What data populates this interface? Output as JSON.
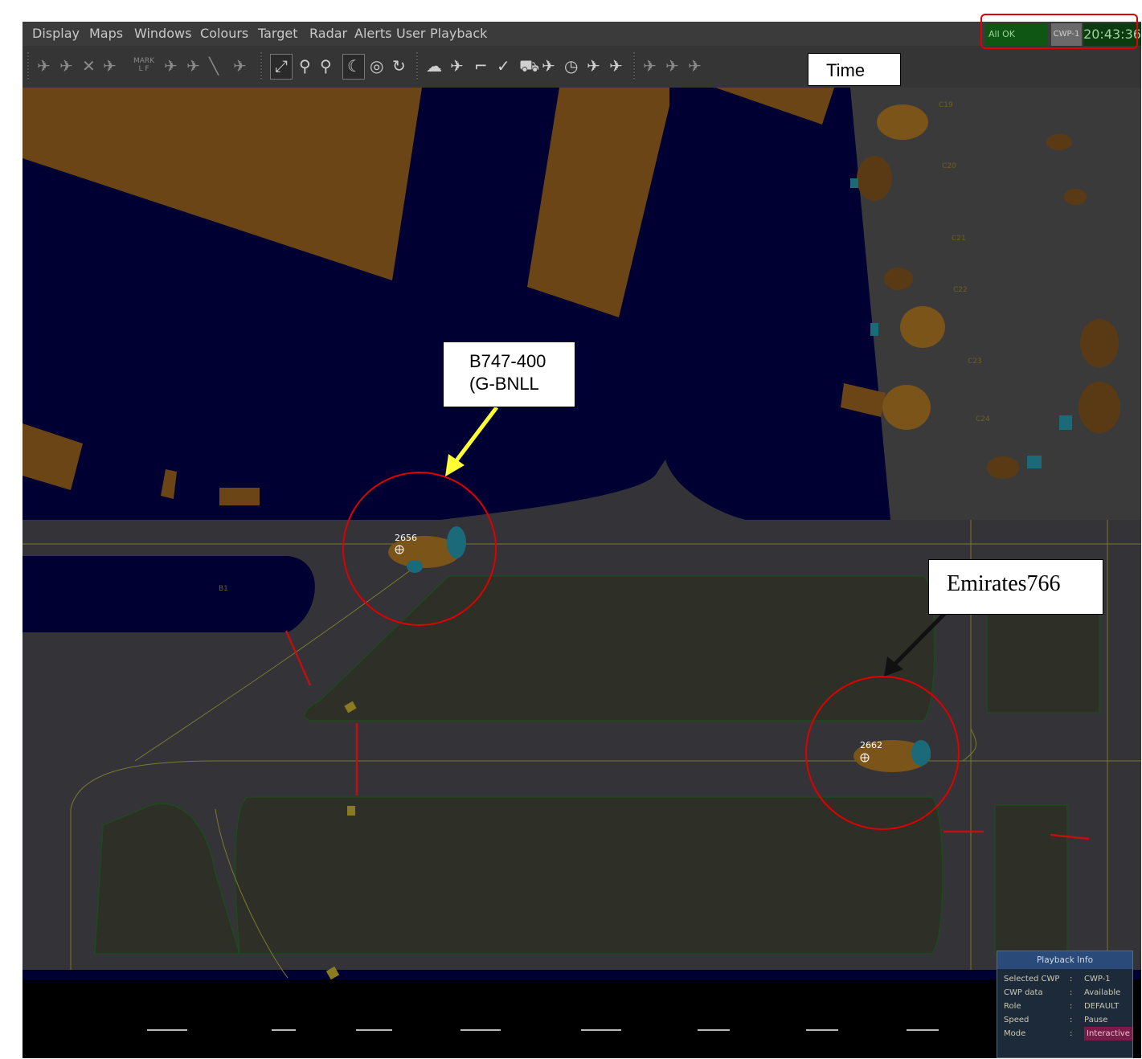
{
  "menu": {
    "items": [
      "Display",
      "Maps",
      "Windows",
      "Colours",
      "Target",
      "Radar",
      "Alerts",
      "User",
      "Playback"
    ]
  },
  "toolbar": {
    "mark_tool_label_top": "MARK",
    "mark_tool_label_bottom": "L F",
    "icons": [
      "track-icon",
      "aircraft-psr-icon",
      "cross-plane-icon",
      "label-plane-icon",
      "mark-icon",
      "plane-a-icon",
      "plane-b-icon",
      "runway-icon",
      "plane-c-icon",
      "pin-tool-icon",
      "zoom-out-icon",
      "zoom-in-icon",
      "moon-icon",
      "radar-circle-icon",
      "refresh-icon",
      "weather-icon",
      "plane-zero-icon",
      "boot-icon",
      "checkmark-icon",
      "vehicle-icon",
      "search-plane-icon",
      "clock-icon",
      "jet-icon",
      "jet-alt-icon",
      "plane-mark-icon",
      "only-icon",
      "mark-plus-icon"
    ]
  },
  "status": {
    "system_status": "All OK",
    "cwp": "CWP-1",
    "time": "20:43:36"
  },
  "annotations": {
    "time_label": "Time",
    "aircraft_1_line1": "B747-400",
    "aircraft_1_line2": "(G-BNLL",
    "aircraft_2": "Emirates766"
  },
  "targets": [
    {
      "id": "2656"
    },
    {
      "id": "2662"
    }
  ],
  "map_labels": {
    "stand_b1": "B1",
    "stand_c19": "C19",
    "stand_c20": "C20",
    "stand_c21": "C21",
    "stand_c22": "C22",
    "stand_c23": "C23",
    "stand_c24": "C24"
  },
  "playback_info": {
    "title": "Playback Info",
    "rows": [
      {
        "key": "Selected CWP",
        "value": "CWP-1"
      },
      {
        "key": "CWP data",
        "value": "Available"
      },
      {
        "key": "Role",
        "value": "DEFAULT"
      },
      {
        "key": "Speed",
        "value": "Pause"
      },
      {
        "key": "Mode",
        "value": "Interactive"
      }
    ]
  },
  "colors": {
    "background": "#1b1b2e",
    "water": "#000033",
    "taxiway": "#3a3a3a",
    "building": "#6b4515",
    "highlight_red": "#e00000",
    "arrow_yellow": "#ffff33",
    "status_green": "#0f5514"
  }
}
